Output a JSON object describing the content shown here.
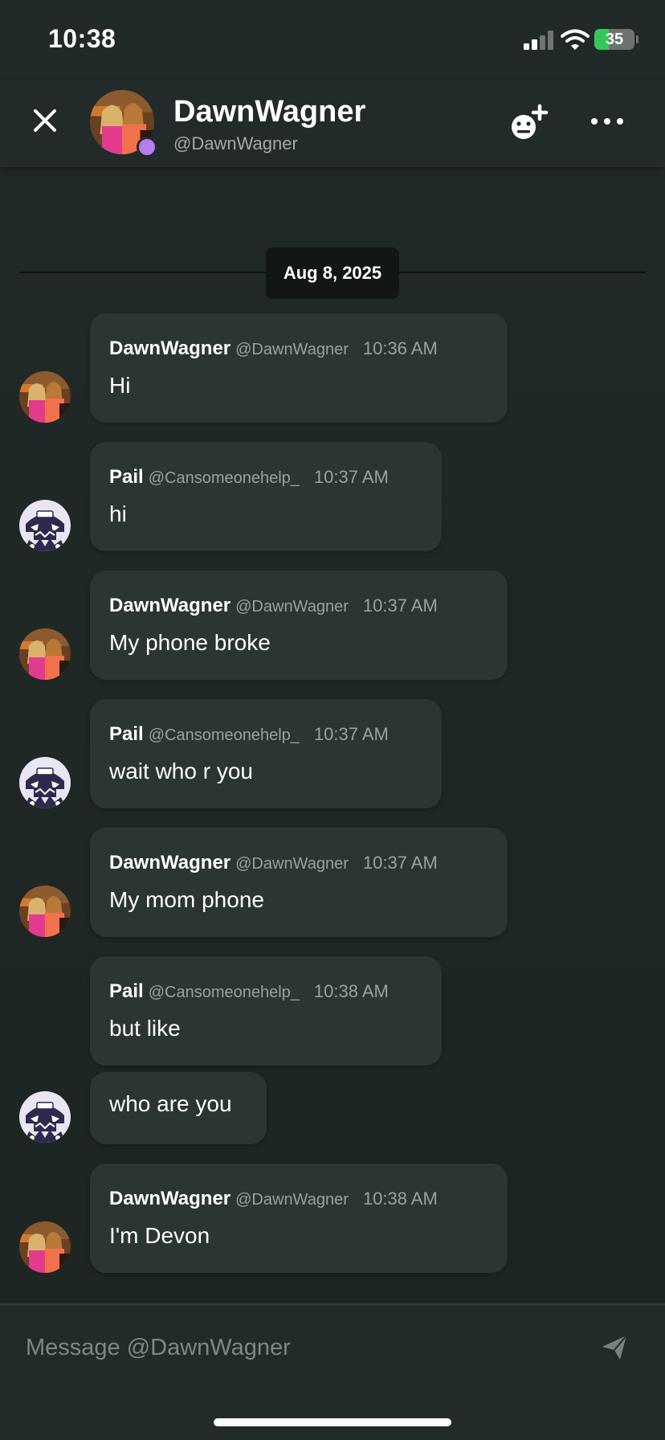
{
  "status_bar": {
    "time": "10:38",
    "battery_text": "35",
    "battery_level_percent": 35,
    "battery_color": "#35c759",
    "icons": [
      "signal-icon",
      "wifi-icon",
      "battery-icon"
    ]
  },
  "header": {
    "name": "DawnWagner",
    "handle": "@DawnWagner",
    "presence_color": "#b77ef0",
    "icons": [
      "close-icon",
      "add-emoji-icon",
      "more-icon"
    ]
  },
  "date_divider": "Aug 8, 2025",
  "messages": [
    {
      "name": "DawnWagner",
      "handle": "@DawnWagner",
      "time": "10:36 AM",
      "text": "Hi",
      "avatar": "photo-avatar"
    },
    {
      "name": "Pail",
      "handle": "@Cansomeonehelp_",
      "time": "10:37 AM",
      "text": "hi",
      "avatar": "cartoon-avatar"
    },
    {
      "name": "DawnWagner",
      "handle": "@DawnWagner",
      "time": "10:37 AM",
      "text": "My phone broke",
      "avatar": "photo-avatar"
    },
    {
      "name": "Pail",
      "handle": "@Cansomeonehelp_",
      "time": "10:37 AM",
      "text": "wait who r you",
      "avatar": "cartoon-avatar"
    },
    {
      "name": "DawnWagner",
      "handle": "@DawnWagner",
      "time": "10:37 AM",
      "text": "My mom phone",
      "avatar": "photo-avatar"
    },
    {
      "name": "Pail",
      "handle": "@Cansomeonehelp_",
      "time": "10:38 AM",
      "text": "but like",
      "avatar": "cartoon-avatar"
    },
    {
      "text": "who are you"
    },
    {
      "name": "DawnWagner",
      "handle": "@DawnWagner",
      "time": "10:38 AM",
      "text": "I'm Devon",
      "avatar": "photo-avatar"
    }
  ],
  "compose": {
    "placeholder": "Message @DawnWagner",
    "send_icon": "send-icon"
  }
}
